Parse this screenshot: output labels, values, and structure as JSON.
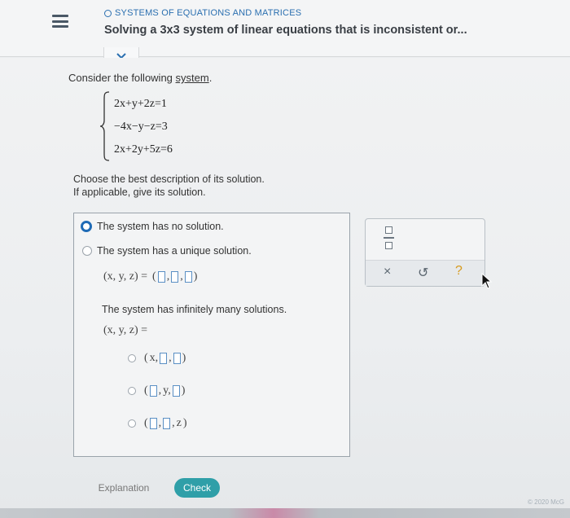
{
  "header": {
    "topic": "SYSTEMS OF EQUATIONS AND MATRICES",
    "title": "Solving a 3x3 system of linear equations that is inconsistent or..."
  },
  "problem": {
    "prompt_prefix": "Consider the following",
    "prompt_link": "system",
    "prompt_suffix": ".",
    "equations": [
      "2x+y+2z=1",
      "−4x−y−z=3",
      "2x+2y+5z=6"
    ],
    "instruction_line1": "Choose the best description of its solution.",
    "instruction_line2": "If applicable, give its solution."
  },
  "answer": {
    "selected_index": 0,
    "option_no_solution": "The system has no solution.",
    "option_unique": "The system has a unique solution.",
    "unique_lhs": "(x, y, z) =",
    "option_infinite": "The system has infinitely many solutions.",
    "infinite_lhs": "(x, y, z) =",
    "sub_x": "x,",
    "sub_y": "y,",
    "sub_z": "z"
  },
  "tools": {
    "close_glyph": "×",
    "undo_glyph": "↺",
    "help_glyph": "?"
  },
  "actions": {
    "explanation": "Explanation",
    "check": "Check"
  },
  "footer": {
    "copyright": "© 2020 McG"
  },
  "colors": {
    "accent": "#1f6bb6",
    "check_button": "#2f9fa8",
    "help": "#d79a1c"
  },
  "icons": [
    "menu-icon",
    "chevron-down-icon",
    "fraction-icon",
    "close-icon",
    "undo-icon",
    "help-icon",
    "mouse-cursor-icon"
  ]
}
